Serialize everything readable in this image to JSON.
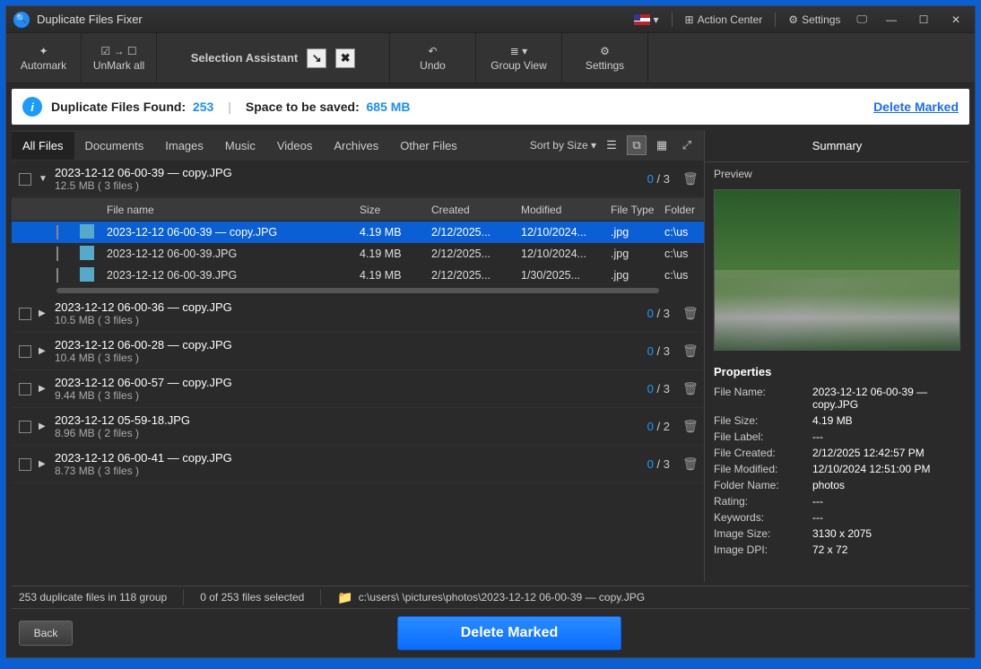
{
  "app_title": "Duplicate Files Fixer",
  "titlebar": {
    "action_center": "Action Center",
    "settings": "Settings"
  },
  "toolbar": {
    "automark": "Automark",
    "unmark": "UnMark all",
    "selection_assistant": "Selection Assistant",
    "undo": "Undo",
    "group_view": "Group View",
    "settings": "Settings"
  },
  "summary": {
    "found_label": "Duplicate Files Found:",
    "found_count": "253",
    "space_label": "Space to be saved:",
    "space_value": "685 MB",
    "delete_marked": "Delete Marked"
  },
  "tabs": [
    "All Files",
    "Documents",
    "Images",
    "Music",
    "Videos",
    "Archives",
    "Other Files"
  ],
  "sort_label": "Sort by Size",
  "columns": {
    "name": "File name",
    "size": "Size",
    "created": "Created",
    "modified": "Modified",
    "type": "File Type",
    "folder": "Folder"
  },
  "groups": [
    {
      "title": "2023-12-12 06-00-39 — copy.JPG",
      "sub": "12.5 MB  ( 3 files )",
      "cur": "0",
      "tot": "3",
      "expanded": true,
      "rows": [
        {
          "name": "2023-12-12 06-00-39 — copy.JPG",
          "size": "4.19 MB",
          "created": "2/12/2025...",
          "modified": "12/10/2024...",
          "type": ".jpg",
          "folder": "c:\\us",
          "selected": true
        },
        {
          "name": "2023-12-12 06-00-39.JPG",
          "size": "4.19 MB",
          "created": "2/12/2025...",
          "modified": "12/10/2024...",
          "type": ".jpg",
          "folder": "c:\\us",
          "selected": false
        },
        {
          "name": "2023-12-12 06-00-39.JPG",
          "size": "4.19 MB",
          "created": "2/12/2025...",
          "modified": "1/30/2025...",
          "type": ".jpg",
          "folder": "c:\\us",
          "selected": false
        }
      ]
    },
    {
      "title": "2023-12-12 06-00-36 — copy.JPG",
      "sub": "10.5 MB  ( 3 files )",
      "cur": "0",
      "tot": "3",
      "expanded": false
    },
    {
      "title": "2023-12-12 06-00-28 — copy.JPG",
      "sub": "10.4 MB  ( 3 files )",
      "cur": "0",
      "tot": "3",
      "expanded": false
    },
    {
      "title": "2023-12-12 06-00-57 — copy.JPG",
      "sub": "9.44 MB  ( 3 files )",
      "cur": "0",
      "tot": "3",
      "expanded": false
    },
    {
      "title": "2023-12-12 05-59-18.JPG",
      "sub": "8.96 MB  ( 2 files )",
      "cur": "0",
      "tot": "2",
      "expanded": false
    },
    {
      "title": "2023-12-12 06-00-41 — copy.JPG",
      "sub": "8.73 MB  ( 3 files )",
      "cur": "0",
      "tot": "3",
      "expanded": false
    }
  ],
  "right": {
    "title": "Summary",
    "preview_label": "Preview",
    "props_title": "Properties",
    "props": [
      {
        "label": "File Name:",
        "value": "2023-12-12 06-00-39 — copy.JPG"
      },
      {
        "label": "File Size:",
        "value": "4.19 MB"
      },
      {
        "label": "File Label:",
        "value": "---"
      },
      {
        "label": "File Created:",
        "value": "2/12/2025 12:42:57 PM"
      },
      {
        "label": "File Modified:",
        "value": "12/10/2024 12:51:00 PM"
      },
      {
        "label": "Folder Name:",
        "value": "photos"
      },
      {
        "label": "Rating:",
        "value": "---"
      },
      {
        "label": "Keywords:",
        "value": "---"
      },
      {
        "label": "Image Size:",
        "value": "3130 x 2075"
      },
      {
        "label": "Image DPI:",
        "value": "72 x 72"
      }
    ]
  },
  "status": {
    "left": "253 duplicate files in 118 group",
    "mid": "0 of 253 files selected",
    "path": "c:\\users\\            \\pictures\\photos\\2023-12-12 06-00-39 — copy.JPG"
  },
  "footer": {
    "back": "Back",
    "delete": "Delete Marked"
  }
}
